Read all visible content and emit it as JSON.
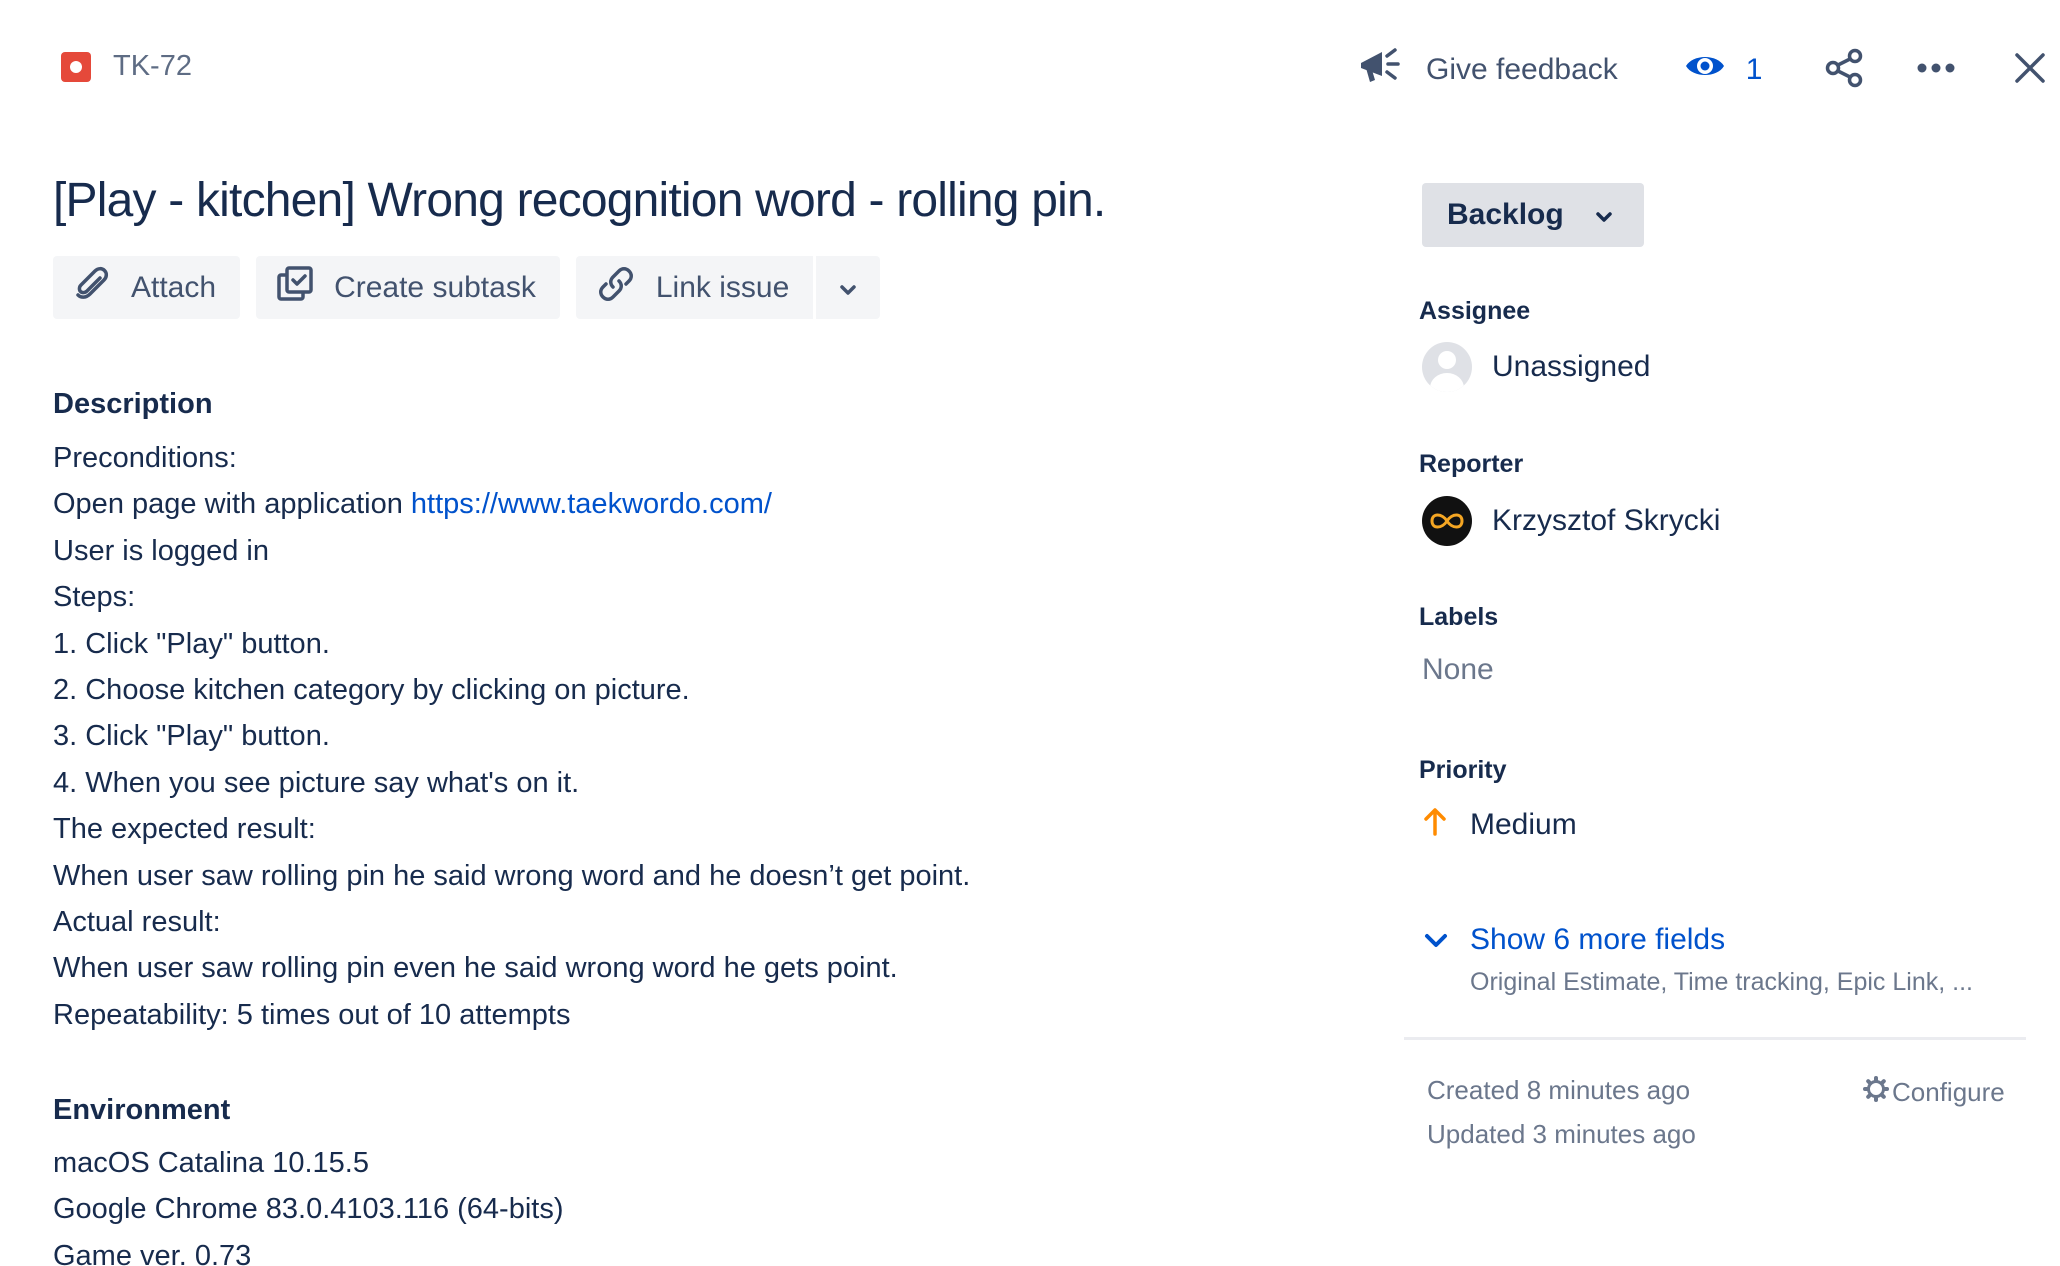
{
  "header": {
    "issue_key": "TK-72",
    "feedback_label": "Give feedback",
    "watch_count": "1"
  },
  "issue": {
    "title": "[Play - kitchen] Wrong recognition word - rolling pin."
  },
  "toolbar": {
    "attach_label": "Attach",
    "create_subtask_label": "Create subtask",
    "link_issue_label": "Link issue"
  },
  "description": {
    "heading": "Description",
    "lines": [
      "Preconditions:",
      "Open page with application",
      "User is logged in",
      "Steps:",
      "1. Click \"Play\" button.",
      "2. Choose kitchen category by clicking on picture.",
      "3. Click \"Play\" button.",
      "4. When you see picture say what's on it.",
      "The expected result:",
      "When user saw rolling pin he said wrong word and he doesn’t get point.",
      "Actual result:",
      "When user saw rolling pin even he said wrong word he gets point.",
      "Repeatability: 5 times out of 10 attempts"
    ],
    "link_text": "https://www.taekwordo.com/"
  },
  "environment": {
    "heading": "Environment",
    "lines": [
      "macOS Catalina 10.15.5",
      "Google Chrome 83.0.4103.116 (64-bits)",
      "Game ver. 0.73"
    ]
  },
  "sidebar": {
    "status": "Backlog",
    "assignee_label": "Assignee",
    "assignee_value": "Unassigned",
    "reporter_label": "Reporter",
    "reporter_value": "Krzysztof Skrycki",
    "labels_label": "Labels",
    "labels_value": "None",
    "priority_label": "Priority",
    "priority_value": "Medium",
    "show_more_label": "Show 6 more fields",
    "show_more_sub": "Original Estimate, Time tracking, Epic Link, ...",
    "created": "Created 8 minutes ago",
    "updated": "Updated 3 minutes ago",
    "configure_label": "Configure"
  },
  "colors": {
    "link": "#0052cc",
    "bug": "#e5493a",
    "priority_medium": "#ff8b00",
    "text": "#172b4d",
    "subtle": "#6b778c"
  },
  "icons": [
    "bug-icon",
    "megaphone-icon",
    "eye-icon",
    "share-icon",
    "more-icon",
    "close-icon",
    "paperclip-icon",
    "subtask-icon",
    "link-icon",
    "chevron-down-icon",
    "avatar-icon",
    "arrow-up-icon",
    "gear-icon"
  ]
}
